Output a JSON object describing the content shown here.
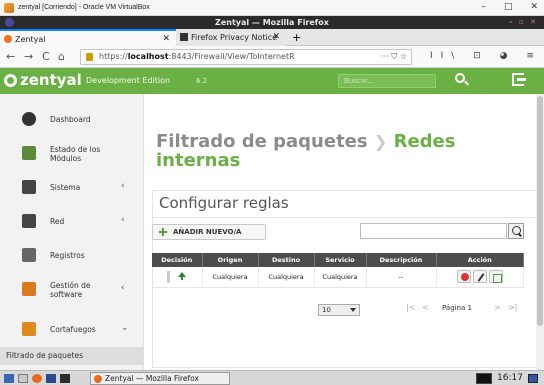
{
  "vbox": {
    "title": "zentyal [Corriendo] - Oracle VM VirtualBox",
    "controls": [
      "–",
      "□",
      "✕"
    ]
  },
  "firefox": {
    "window_title": "Zentyal — Mozilla Firefox",
    "title_controls": "– ▫ ✕",
    "tabs": [
      {
        "label": "Zentyal",
        "close": "✕"
      },
      {
        "label": "Firefox Privacy Notice —",
        "close": "✕"
      }
    ],
    "newtab": "+",
    "nav": {
      "back": "←",
      "forward": "→",
      "reload": "C",
      "home": "⌂",
      "shield": "⛉"
    },
    "url_prefix": "https://",
    "url_host": "localhost",
    "url_rest": ":8443/Firewall/View/ToInternetR",
    "url_extras": "··· ⛉ ☆",
    "nav_right": "II\\ ⊡ ◕ ≡"
  },
  "app": {
    "logo": "zentyal",
    "edition": "Development Edition",
    "version": "6.2",
    "search_placeholder": "Buscar..."
  },
  "sidebar": {
    "items": [
      {
        "label": "Dashboard",
        "arrow": "",
        "icon": "dashboard-icon",
        "color": "#333333"
      },
      {
        "label": "Estado de los Módulos",
        "arrow": "",
        "icon": "modules-icon",
        "color": "#5b8a3a"
      },
      {
        "label": "Sistema",
        "arrow": "‹",
        "icon": "gear-icon",
        "color": "#444444"
      },
      {
        "label": "Red",
        "arrow": "‹",
        "icon": "network-icon",
        "color": "#444444"
      },
      {
        "label": "Registros",
        "arrow": "",
        "icon": "logs-icon",
        "color": "#666666"
      },
      {
        "label": "Gestión de software",
        "arrow": "‹",
        "icon": "software-icon",
        "color": "#d97a20"
      },
      {
        "label": "Cortafuegos",
        "arrow": "⌄",
        "icon": "firewall-icon",
        "color": "#e08a1c"
      }
    ],
    "footer": "Filtrado de paquetes"
  },
  "main": {
    "title_part1": "Filtrado de paquetes",
    "title_sep": "❯",
    "title_part2": "Redes internas",
    "panel_title": "Configurar reglas",
    "add_button": "AÑADIR NUEVO/A",
    "table": {
      "headers": [
        "Decisión",
        "Origen",
        "Destino",
        "Servicio",
        "Descripción",
        "Acción"
      ],
      "rows": [
        {
          "decision": "accept",
          "origen": "Cualquiera",
          "destino": "Cualquiera",
          "servicio": "Cualquiera",
          "descripcion": "--"
        }
      ]
    },
    "pager": {
      "page_size": "10",
      "first": "|<",
      "prev": "<",
      "page_label": "Página 1",
      "next": ">",
      "last": ">|"
    }
  },
  "taskbar": {
    "app_label": "Zentyal — Mozilla Firefox",
    "clock": "16:17"
  },
  "colors": {
    "brand_green": "#6bb045",
    "header_dark": "#4d4d4d"
  }
}
